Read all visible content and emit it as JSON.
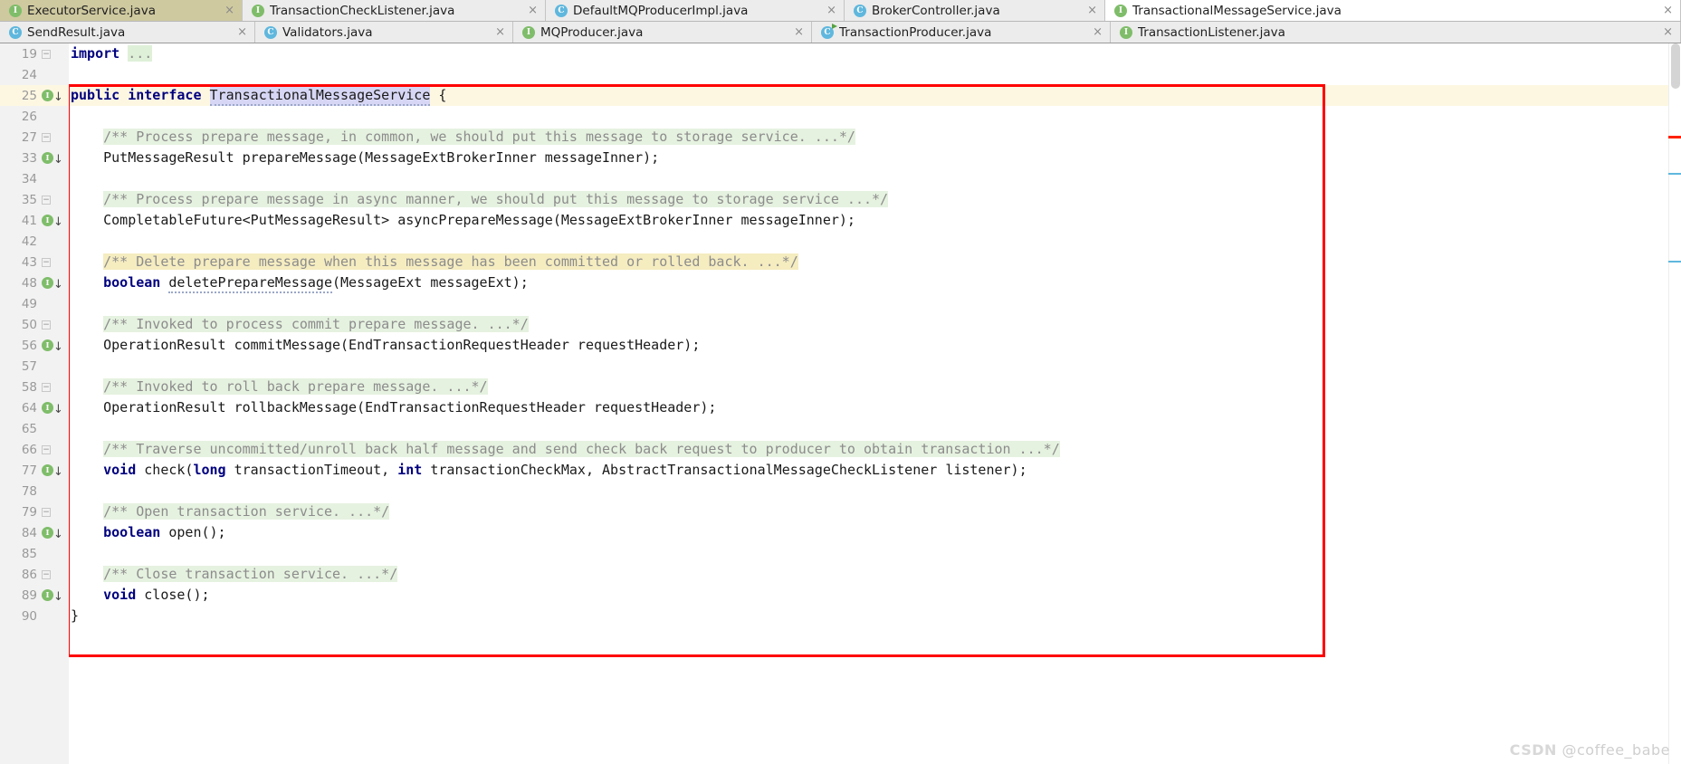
{
  "window": {
    "active_file": "TransactionalMessageService.java",
    "colors": {
      "accent_red": "#ff0000",
      "interface_icon": "#7fbd6a",
      "class_icon": "#5fb7dd",
      "comment_fold_bg": "#e6f2e0",
      "search_hit_bg": "#f5ecc0",
      "caret_line_bg": "#fdf7e2",
      "selection_bg": "#d7d7f5"
    }
  },
  "tabs_row1": [
    {
      "label": "ExecutorService.java",
      "icon": "interface-icon",
      "state": "inactive-olive",
      "close": "×"
    },
    {
      "label": "TransactionCheckListener.java",
      "icon": "interface-icon",
      "state": "inactive",
      "close": "×"
    },
    {
      "label": "DefaultMQProducerImpl.java",
      "icon": "class-icon",
      "state": "inactive",
      "close": "×"
    },
    {
      "label": "BrokerController.java",
      "icon": "class-icon",
      "state": "inactive",
      "close": "×"
    },
    {
      "label": "TransactionalMessageService.java",
      "icon": "interface-icon",
      "state": "active",
      "close": "×"
    }
  ],
  "tabs_row2": [
    {
      "label": "SendResult.java",
      "icon": "class-icon",
      "state": "inactive",
      "close": "×"
    },
    {
      "label": "Validators.java",
      "icon": "class-icon",
      "state": "inactive",
      "close": "×"
    },
    {
      "label": "MQProducer.java",
      "icon": "interface-icon",
      "state": "inactive",
      "close": "×"
    },
    {
      "label": "TransactionProducer.java",
      "icon": "class-runnable-icon",
      "state": "inactive",
      "close": "×"
    },
    {
      "label": "TransactionListener.java",
      "icon": "interface-icon",
      "state": "inactive",
      "close": "×"
    }
  ],
  "gutter": {
    "fold_glyph": "−",
    "impl_letter": "I",
    "impl_arrow": "↓",
    "rows": [
      {
        "n": "19",
        "fold": true,
        "impl": false,
        "hl": false
      },
      {
        "n": "24",
        "fold": false,
        "impl": false,
        "hl": false
      },
      {
        "n": "25",
        "fold": false,
        "impl": true,
        "hl": true
      },
      {
        "n": "26",
        "fold": false,
        "impl": false,
        "hl": false
      },
      {
        "n": "27",
        "fold": true,
        "impl": false,
        "hl": false
      },
      {
        "n": "33",
        "fold": false,
        "impl": true,
        "hl": false
      },
      {
        "n": "34",
        "fold": false,
        "impl": false,
        "hl": false
      },
      {
        "n": "35",
        "fold": true,
        "impl": false,
        "hl": false
      },
      {
        "n": "41",
        "fold": false,
        "impl": true,
        "hl": false
      },
      {
        "n": "42",
        "fold": false,
        "impl": false,
        "hl": false
      },
      {
        "n": "43",
        "fold": true,
        "impl": false,
        "hl": false
      },
      {
        "n": "48",
        "fold": false,
        "impl": true,
        "hl": false
      },
      {
        "n": "49",
        "fold": false,
        "impl": false,
        "hl": false
      },
      {
        "n": "50",
        "fold": true,
        "impl": false,
        "hl": false
      },
      {
        "n": "56",
        "fold": false,
        "impl": true,
        "hl": false
      },
      {
        "n": "57",
        "fold": false,
        "impl": false,
        "hl": false
      },
      {
        "n": "58",
        "fold": true,
        "impl": false,
        "hl": false
      },
      {
        "n": "64",
        "fold": false,
        "impl": true,
        "hl": false
      },
      {
        "n": "65",
        "fold": false,
        "impl": false,
        "hl": false
      },
      {
        "n": "66",
        "fold": true,
        "impl": false,
        "hl": false
      },
      {
        "n": "77",
        "fold": false,
        "impl": true,
        "hl": false
      },
      {
        "n": "78",
        "fold": false,
        "impl": false,
        "hl": false
      },
      {
        "n": "79",
        "fold": true,
        "impl": false,
        "hl": false
      },
      {
        "n": "84",
        "fold": false,
        "impl": true,
        "hl": false
      },
      {
        "n": "85",
        "fold": false,
        "impl": false,
        "hl": false
      },
      {
        "n": "86",
        "fold": true,
        "impl": false,
        "hl": false
      },
      {
        "n": "89",
        "fold": false,
        "impl": true,
        "hl": false
      },
      {
        "n": "90",
        "fold": false,
        "impl": false,
        "hl": false
      }
    ]
  },
  "code_lines": [
    "import ...",
    "",
    "public interface TransactionalMessageService {",
    "",
    "    /** Process prepare message, in common, we should put this message to storage service. ...*/",
    "    PutMessageResult prepareMessage(MessageExtBrokerInner messageInner);",
    "",
    "    /** Process prepare message in async manner, we should put this message to storage service ...*/",
    "    CompletableFuture<PutMessageResult> asyncPrepareMessage(MessageExtBrokerInner messageInner);",
    "",
    "    /** Delete prepare message when this message has been committed or rolled back. ...*/",
    "    boolean deletePrepareMessage(MessageExt messageExt);",
    "",
    "    /** Invoked to process commit prepare message. ...*/",
    "    OperationResult commitMessage(EndTransactionRequestHeader requestHeader);",
    "",
    "    /** Invoked to roll back prepare message. ...*/",
    "    OperationResult rollbackMessage(EndTransactionRequestHeader requestHeader);",
    "",
    "    /** Traverse uncommitted/unroll back half message and send check back request to producer to obtain transaction ...*/",
    "    void check(long transactionTimeout, int transactionCheckMax, AbstractTransactionalMessageCheckListener listener);",
    "",
    "    /** Open transaction service. ...*/",
    "    boolean open();",
    "",
    "    /** Close transaction service. ...*/",
    "    void close();",
    "}"
  ],
  "watermark": {
    "brand": "CSDN",
    "user": "@coffee_babe"
  }
}
